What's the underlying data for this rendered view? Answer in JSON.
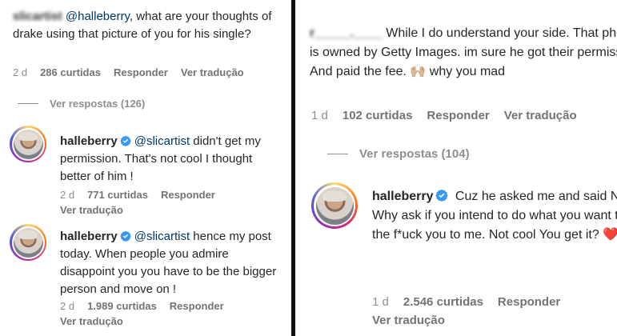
{
  "left": {
    "comment1": {
      "user": "slicartist",
      "mention": "@halleberry",
      "text": ", what are your thoughts of drake using that picture of you for his single?",
      "time": "2 d",
      "likes": "286 curtidas",
      "reply": "Responder",
      "translate": "Ver tradução"
    },
    "view_replies": "Ver respostas (126)",
    "reply1": {
      "user": "halleberry",
      "mention": "@slicartist",
      "text": " didn't get my permission. That's not cool I thought better of him !",
      "time": "2 d",
      "likes": "771 curtidas",
      "reply": "Responder",
      "translate": "Ver tradução"
    },
    "reply2": {
      "user": "halleberry",
      "mention": "@slicartist",
      "text": " hence my post today. When people you admire disappoint you you have to be the bigger person and move on !",
      "time": "2 d",
      "likes": "1.989 curtidas",
      "reply": "Responder",
      "translate": "Ver tradução"
    }
  },
  "right": {
    "comment1": {
      "user": "r_____.____",
      "text": " While I do understand your side. That photo is owned by Getty Images. im sure he got their permission. And paid the fee. 🙌🏼 why you mad",
      "time": "1 d",
      "likes": "102 curtidas",
      "reply": "Responder",
      "translate": "Ver tradução"
    },
    "view_replies": "Ver respostas (104)",
    "reply1": {
      "user": "halleberry",
      "text": " Cuz he asked me and said NO that's why. Why ask if you intend to do what you want to do ! That was the f*uck you to me. Not cool You get it? ❤️",
      "time": "1 d",
      "likes": "2.546 curtidas",
      "reply": "Responder",
      "translate": "Ver tradução"
    }
  },
  "colors": {
    "verified": "#3897f0",
    "mention": "#00376b",
    "heart": "#ed4956"
  },
  "icons": {
    "verified": "verified-badge-icon",
    "avatar": "story-ring-avatar"
  }
}
